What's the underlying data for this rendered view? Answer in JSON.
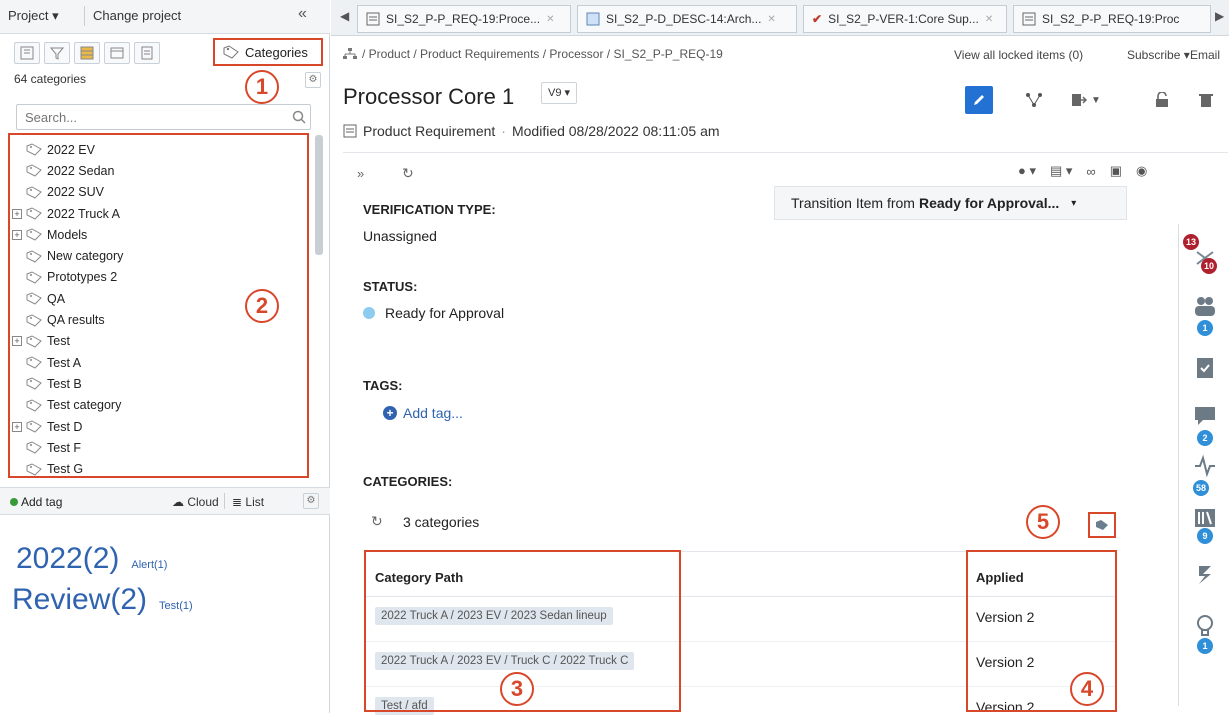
{
  "topbar": {
    "project_label": "Project ▾",
    "change_project": "Change project",
    "collapse": "«"
  },
  "left": {
    "categories_tab": "Categories",
    "count_label": "64 categories",
    "search_placeholder": "Search...",
    "tree": [
      {
        "label": "2022 EV",
        "expandable": false
      },
      {
        "label": "2022 Sedan",
        "expandable": false
      },
      {
        "label": "2022 SUV",
        "expandable": false
      },
      {
        "label": "2022 Truck A",
        "expandable": true
      },
      {
        "label": "Models",
        "expandable": true
      },
      {
        "label": "New category",
        "expandable": false
      },
      {
        "label": "Prototypes 2",
        "expandable": false
      },
      {
        "label": "QA",
        "expandable": false
      },
      {
        "label": "QA results",
        "expandable": false
      },
      {
        "label": "Test",
        "expandable": true
      },
      {
        "label": "Test A",
        "expandable": false
      },
      {
        "label": "Test B",
        "expandable": false
      },
      {
        "label": "Test category",
        "expandable": false
      },
      {
        "label": "Test D",
        "expandable": true
      },
      {
        "label": "Test F",
        "expandable": false
      },
      {
        "label": "Test G",
        "expandable": false
      }
    ],
    "add_tag": "Add tag",
    "cloud": "Cloud",
    "list": "List",
    "tag_cloud": [
      {
        "big": "2022(2)",
        "small": "Alert(1)"
      },
      {
        "big": "Review(2)",
        "small": "Test(1)"
      }
    ]
  },
  "annotations": {
    "n1": "1",
    "n2": "2",
    "n3": "3",
    "n4": "4",
    "n5": "5"
  },
  "tabs": [
    "SI_S2_P-P_REQ-19:Proce...",
    "SI_S2_P-D_DESC-14:Arch...",
    "SI_S2_P-VER-1:Core Sup...",
    "SI_S2_P-P_REQ-19:Proc"
  ],
  "breadcrumb": "/ Product / Product Requirements / Processor / SI_S2_P-P_REQ-19",
  "header_links": {
    "locked": "View all locked items (0)",
    "subscribe": "Subscribe ▾",
    "email": "Email"
  },
  "item": {
    "title": "Processor Core 1",
    "version": "V9 ▾",
    "type": "Product Requirement",
    "modified": "Modified 08/28/2022 08:11:05 am"
  },
  "transition": {
    "prefix": "Transition Item from ",
    "bold": "Ready for Approval...",
    "caret": "▾"
  },
  "fields": {
    "verification_label": "VERIFICATION TYPE:",
    "verification_value": "Unassigned",
    "status_label": "STATUS:",
    "status_value": "Ready for Approval",
    "tags_label": "TAGS:",
    "add_tag": "Add tag...",
    "categories_label": "CATEGORIES:",
    "categories_count": "3 categories"
  },
  "cat_table": {
    "col_path": "Category Path",
    "col_applied": "Applied",
    "rows": [
      {
        "path": [
          "2022 Truck A",
          "2023 EV",
          "2023 Sedan lineup"
        ],
        "applied": "Version 2"
      },
      {
        "path": [
          "2022 Truck A",
          "2023 EV",
          "Truck C",
          "2022 Truck C"
        ],
        "applied": "Version 2"
      },
      {
        "path": [
          "Test",
          "afd"
        ],
        "applied": "Version 2"
      }
    ]
  },
  "right_badges": {
    "b1a": "13",
    "b1b": "10",
    "b2": "1",
    "b3": "2",
    "b4": "58",
    "b5": "9",
    "b6": "1"
  },
  "colors": {
    "accent": "#d9472b",
    "primary": "#2f63b0",
    "edit_button": "#2372d3"
  }
}
